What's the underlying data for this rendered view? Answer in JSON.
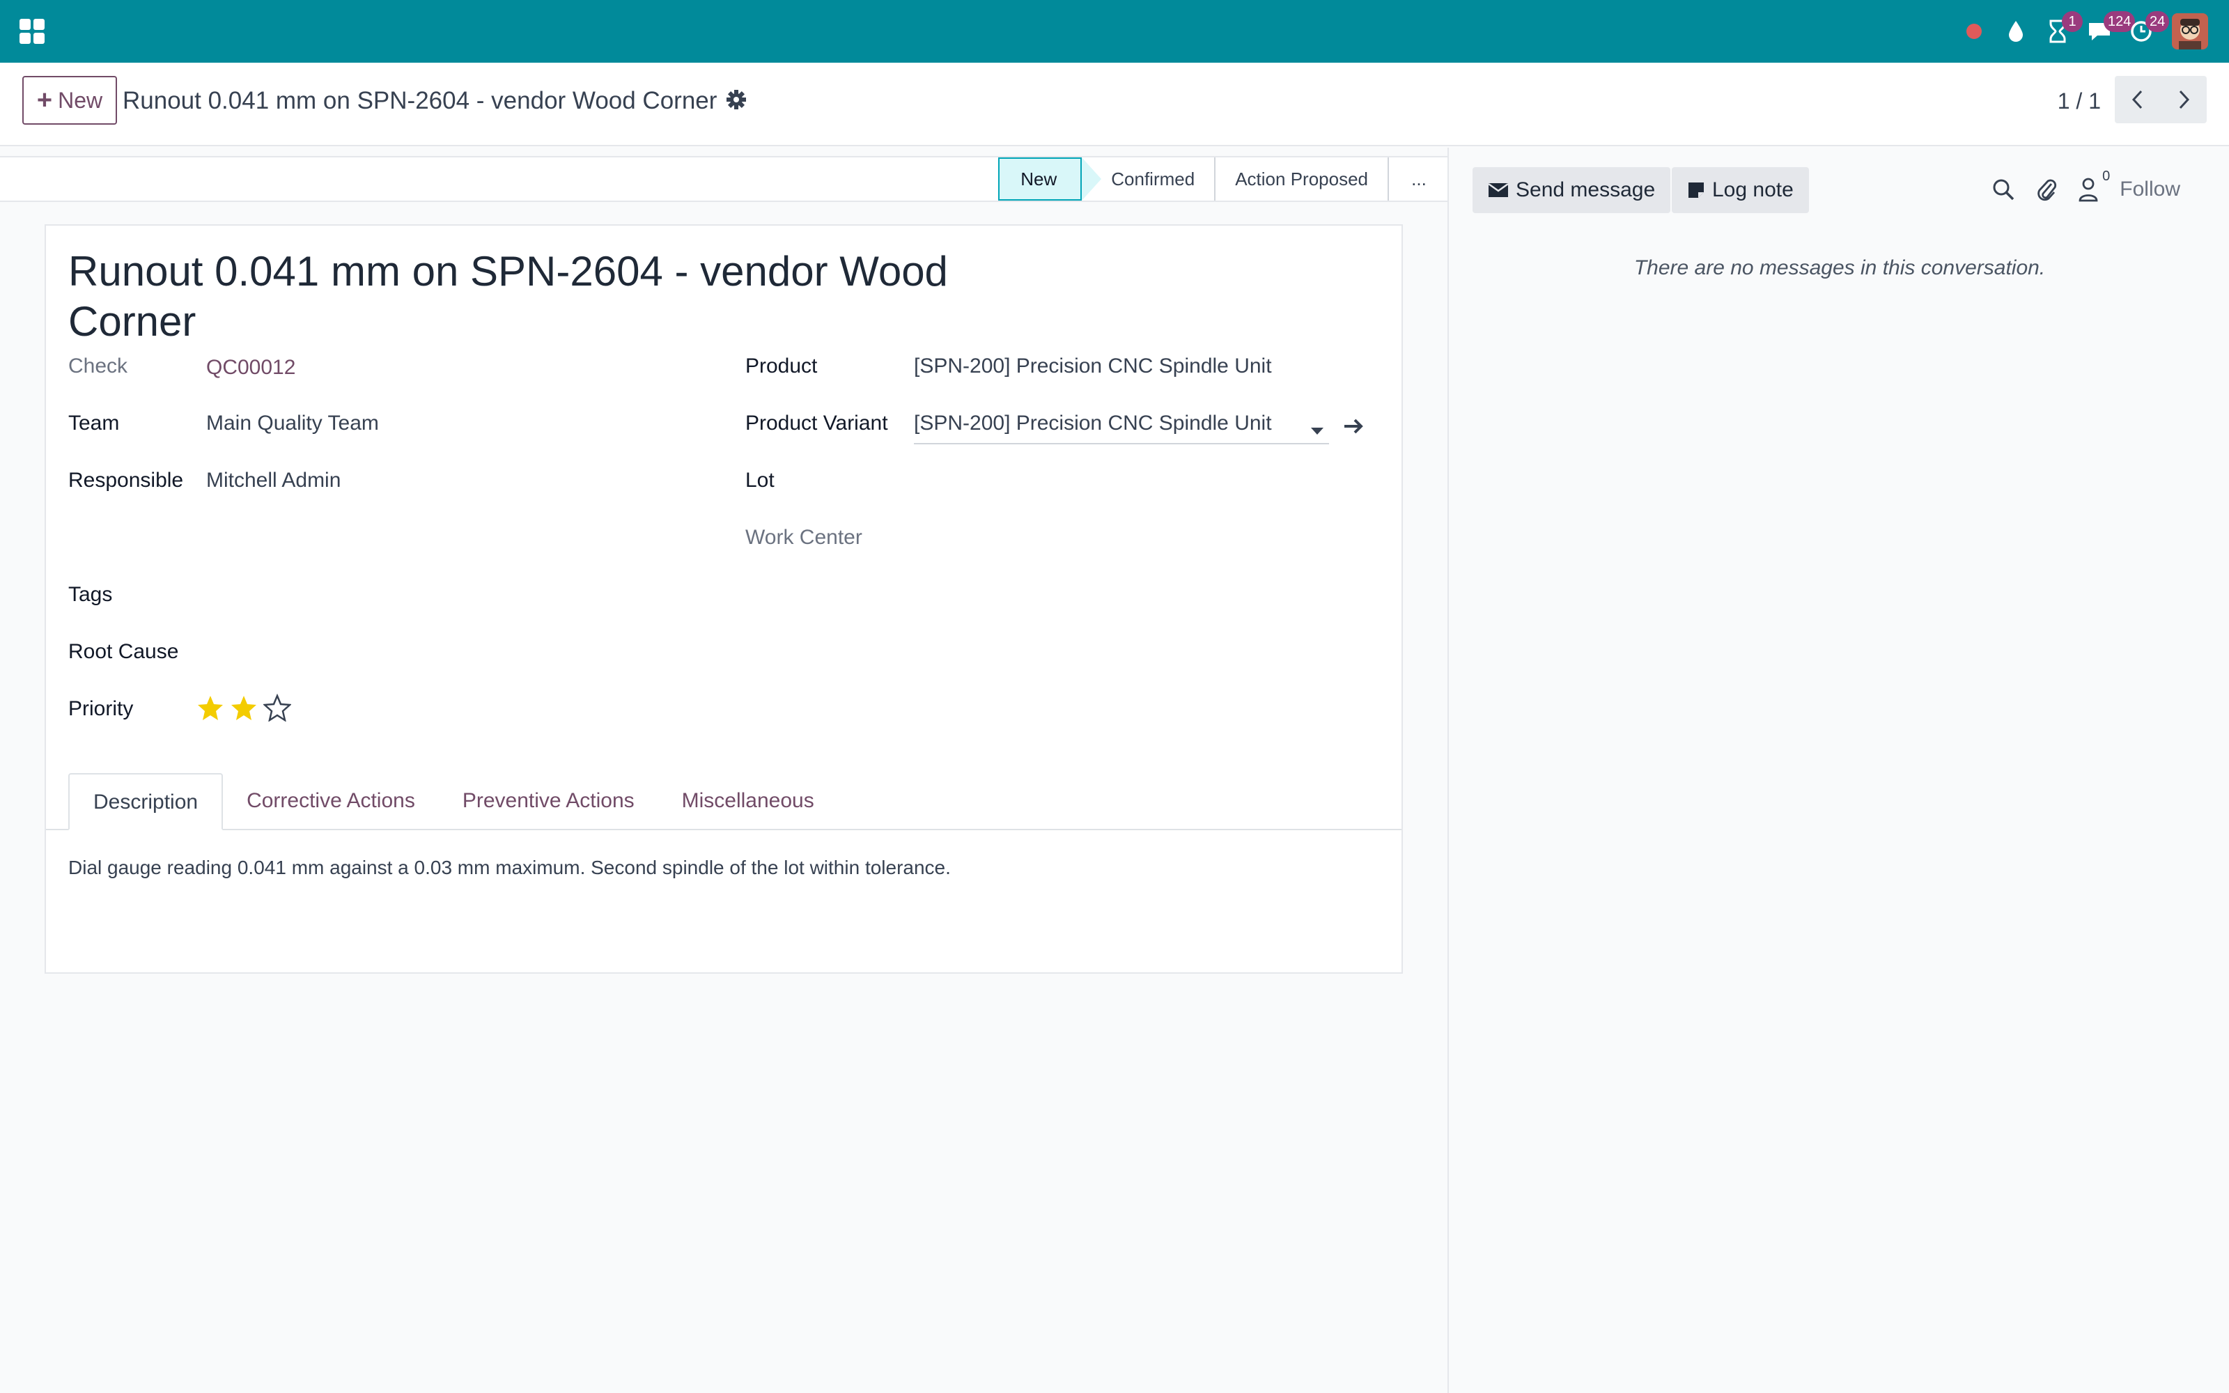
{
  "navbar": {
    "badges": {
      "activities": "1",
      "messages": "124",
      "updates": "24"
    }
  },
  "control_panel": {
    "new_label": "New",
    "title": "Runout 0.041 mm on SPN-2604 - vendor Wood Corner",
    "pager": "1 / 1"
  },
  "statusbar": {
    "stages": [
      "New",
      "Confirmed",
      "Action Proposed",
      "..."
    ],
    "active_stage": "New"
  },
  "form": {
    "title": "Runout 0.041 mm on SPN-2604 - vendor Wood Corner",
    "check_label": "Check",
    "check_value": "QC00012",
    "team_label": "Team",
    "team_value": "Main Quality Team",
    "responsible_label": "Responsible",
    "responsible_value": "Mitchell Admin",
    "product_label": "Product",
    "product_value": "[SPN-200] Precision CNC Spindle Unit",
    "variant_label": "Product Variant",
    "variant_value": "[SPN-200] Precision CNC Spindle Unit",
    "lot_label": "Lot",
    "workcenter_label": "Work Center",
    "tags_label": "Tags",
    "root_cause_label": "Root Cause",
    "priority_label": "Priority",
    "priority_value": 2,
    "priority_max": 3,
    "tabs": [
      "Description",
      "Corrective Actions",
      "Preventive Actions",
      "Miscellaneous"
    ],
    "description": "Dial gauge reading 0.041 mm against a 0.03 mm maximum. Second spindle of the lot within tolerance."
  },
  "chatter": {
    "send_message": "Send message",
    "log_note": "Log note",
    "followers_count": "0",
    "follow": "Follow",
    "empty_text": "There are no messages in this conversation."
  },
  "colors": {
    "navbar": "#018a9a",
    "brand": "#714b67",
    "star": "#f3cc00",
    "stage_active": "#d9f7f9"
  }
}
